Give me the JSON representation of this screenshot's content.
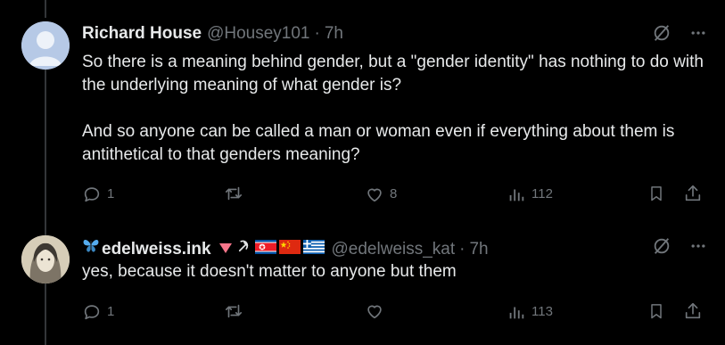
{
  "posts": [
    {
      "author_name": "Richard House",
      "handle": "@Housey101",
      "separator": "·",
      "time": "7h",
      "text": "So there is a meaning behind gender, but a \"gender identity\" has nothing to do with the underlying meaning of what gender is?\n\nAnd so anyone can be called a man or woman even if everything about them is antithetical to that genders meaning?",
      "avatar_icon": "default-avatar-icon",
      "stats": {
        "replies": "1",
        "reposts": "",
        "likes": "8",
        "views": "112"
      }
    },
    {
      "author_name": "edelweiss.ink",
      "name_emojis": [
        "butterfly-icon",
        "red-triangle-icon",
        "hammer-sickle-icon",
        "north-korea-flag-icon",
        "china-flag-icon",
        "greece-flag-icon"
      ],
      "handle": "@edelweiss_kat",
      "separator": "·",
      "time": "7h",
      "text": "yes, because it doesn't matter to anyone but them",
      "avatar_icon": "artwork-avatar-icon",
      "stats": {
        "replies": "1",
        "reposts": "",
        "likes": "",
        "views": "113"
      }
    }
  ],
  "icons": {
    "grok": "grok-icon",
    "more": "more-icon",
    "reply": "reply-icon",
    "repost": "repost-icon",
    "like": "like-icon",
    "views": "views-icon",
    "bookmark": "bookmark-icon",
    "share": "share-icon"
  },
  "colors": {
    "background": "#000000",
    "text_primary": "#e7e9ea",
    "text_secondary": "#71767b",
    "thread_line": "#333639"
  }
}
